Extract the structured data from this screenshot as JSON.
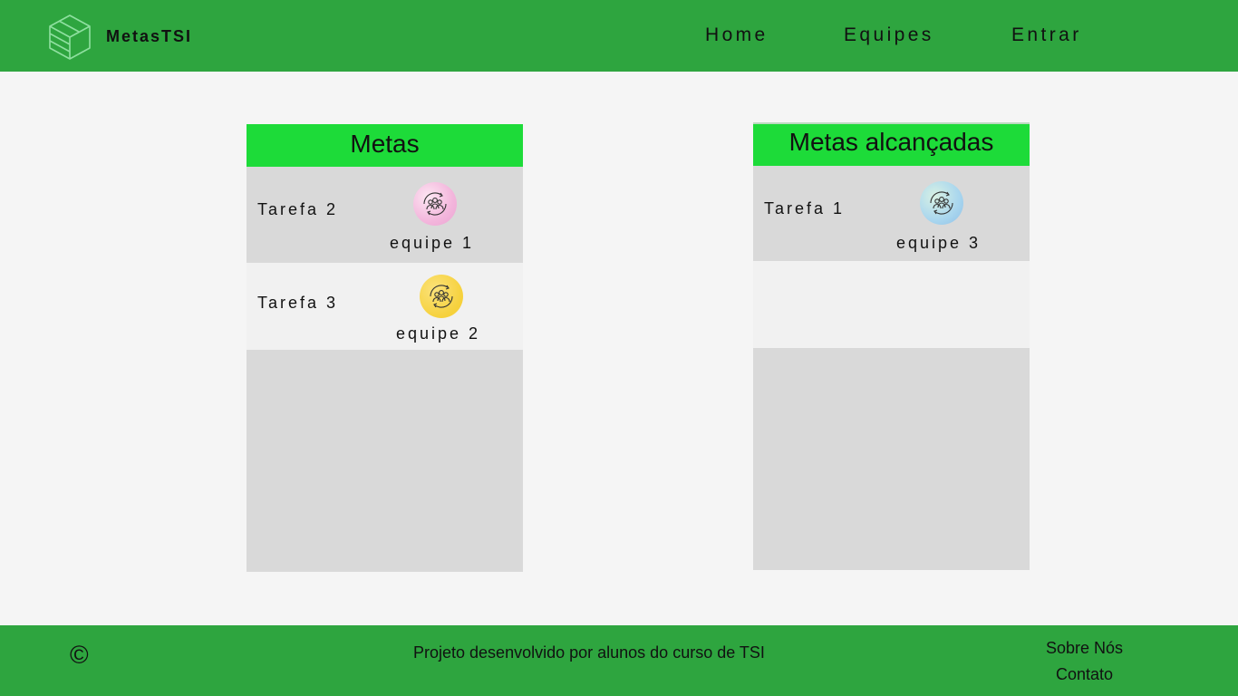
{
  "header": {
    "brand": "MetasTSI",
    "nav": {
      "home": "Home",
      "equipes": "Equipes",
      "entrar": "Entrar"
    },
    "colors": {
      "background": "#2ea53f"
    }
  },
  "boards": {
    "metas": {
      "title": "Metas",
      "items": [
        {
          "task": "Tarefa 2",
          "team": "equipe 1",
          "icon": "team-cycle-icon",
          "icon_color": "#f6c6e4"
        },
        {
          "task": "Tarefa 3",
          "team": "equipe 2",
          "icon": "team-cycle-icon",
          "icon_color": "#f7d448"
        }
      ]
    },
    "alcancadas": {
      "title": "Metas alcançadas",
      "items": [
        {
          "task": "Tarefa 1",
          "team": "equipe 3",
          "icon": "team-cycle-icon",
          "icon_color": "#a9d6ee"
        }
      ]
    },
    "colors": {
      "header": "#1ddb39",
      "body": "#d9d9d9",
      "row_light": "#f1f1f1"
    }
  },
  "footer": {
    "copyright_symbol": "©",
    "credits": "Projeto desenvolvido por alunos do curso de TSI",
    "links": {
      "sobre": "Sobre Nós",
      "contato": "Contato"
    }
  }
}
